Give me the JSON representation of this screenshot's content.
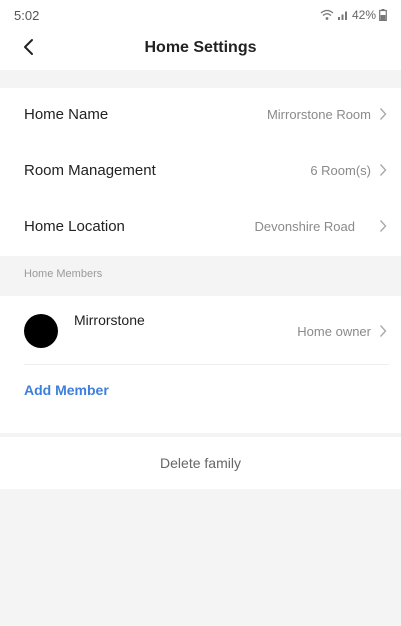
{
  "status_bar": {
    "time": "5:02",
    "battery": "42%",
    "icons": [
      "wifi-icon",
      "signal-icon",
      "battery-icon"
    ]
  },
  "header": {
    "title": "Home Settings",
    "back_icon": "chevron-left-icon"
  },
  "settings": {
    "home_name": {
      "label": "Home Name",
      "value": "Mirrorstone Room"
    },
    "room_management": {
      "label": "Room Management",
      "value": "6 Room(s)"
    },
    "home_location": {
      "label": "Home Location",
      "value": "Devonshire Road"
    }
  },
  "members": {
    "section_label": "Home Members",
    "items": [
      {
        "name": "Mirrorstone",
        "role": "Home owner"
      }
    ],
    "add_label": "Add Member"
  },
  "delete": {
    "label": "Delete family"
  },
  "colors": {
    "accent": "#3d7fdb",
    "background": "#f4f4f4",
    "card": "#ffffff"
  }
}
